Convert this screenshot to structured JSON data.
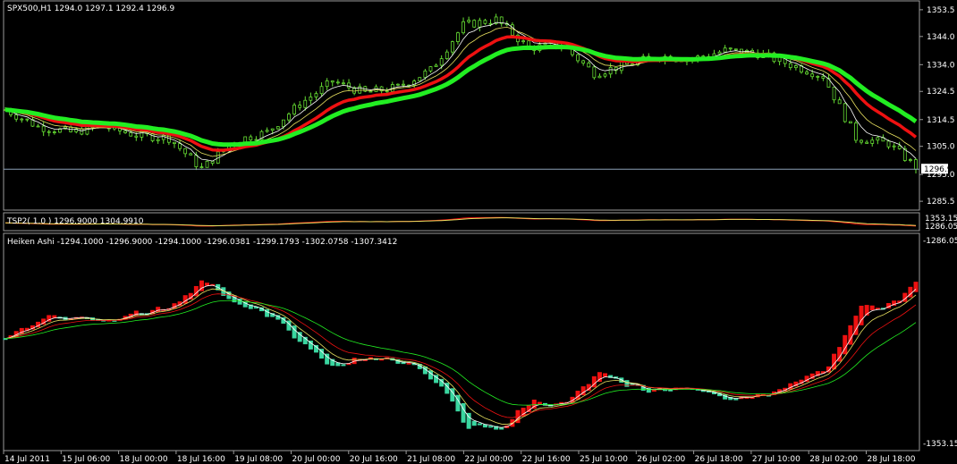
{
  "chart_data": [
    {
      "type": "line",
      "subtype": "candlestick-with-moving-averages",
      "title": "SPX500,H1  1294.0 1297.1 1292.4 1296.9",
      "ohlc": {
        "open": 1294.0,
        "high": 1297.1,
        "low": 1292.4,
        "close": 1296.9
      },
      "current_price": 1296.9,
      "current_price_label": "1296.9",
      "ylim": [
        1283.0,
        1356.0
      ],
      "yticks": [
        1353.5,
        1344.0,
        1334.0,
        1324.5,
        1314.5,
        1305.0,
        1295.0,
        1285.5
      ],
      "ytick_labels": [
        "1353.5",
        "1344.0",
        "1334.0",
        "1324.5",
        "1314.5",
        "1305.0",
        "1295.0",
        "1285.5"
      ],
      "price_anchors": {
        "x": [
          0,
          6,
          12,
          18,
          24,
          30,
          36,
          42,
          48,
          54,
          60,
          66,
          72,
          78,
          84,
          90,
          96,
          102,
          108,
          114,
          120,
          126,
          132,
          138,
          144,
          150,
          156,
          162,
          168
        ],
        "close": [
          1318,
          1312,
          1310,
          1312,
          1309,
          1308,
          1297,
          1307,
          1310,
          1320,
          1328,
          1324,
          1326,
          1332,
          1348,
          1350,
          1340,
          1341,
          1331,
          1334,
          1337,
          1336,
          1339,
          1338,
          1334,
          1330,
          1308,
          1306,
          1296
        ]
      },
      "colors": {
        "bull": "#66dd33",
        "bear": "#66dd33",
        "ma_white": "#ffffff",
        "ma_yellow": "#e8e060",
        "ma_red": "#ee1111",
        "ma_green": "#22ee22"
      }
    },
    {
      "type": "line",
      "title": "TSP2( 1.0 ) 1296.9000 1304.9910",
      "ytick_labels": [
        "1353.15",
        "1286.05"
      ],
      "colors": {
        "line1": "#ee1111",
        "line2": "#e8e060"
      }
    },
    {
      "type": "line",
      "subtype": "heiken-ashi-inverted",
      "title": "Heiken Ashi -1294.1000 -1296.9000 -1294.1000 -1296.0381 -1299.1793 -1302.0758 -1307.3412",
      "ytick_labels": [
        "-1286.05",
        "-1353.15"
      ],
      "ylim": [
        -1356.0,
        -1284.0
      ],
      "colors": {
        "bull": "#3ad6a0",
        "bear": "#ee1111",
        "ma_white": "#ffffff",
        "ma_yellow": "#e8e060",
        "ma_red": "#ee1111",
        "ma_green": "#22ee22"
      }
    }
  ],
  "x_axis": {
    "labels": [
      "14 Jul 2011",
      "15 Jul 06:00",
      "18 Jul 00:00",
      "18 Jul 16:00",
      "19 Jul 08:00",
      "20 Jul 00:00",
      "20 Jul 16:00",
      "21 Jul 08:00",
      "22 Jul 00:00",
      "22 Jul 16:00",
      "25 Jul 10:00",
      "26 Jul 02:00",
      "26 Jul 18:00",
      "27 Jul 10:00",
      "28 Jul 02:00",
      "28 Jul 18:00"
    ],
    "bars_total": 168
  },
  "grid": false
}
